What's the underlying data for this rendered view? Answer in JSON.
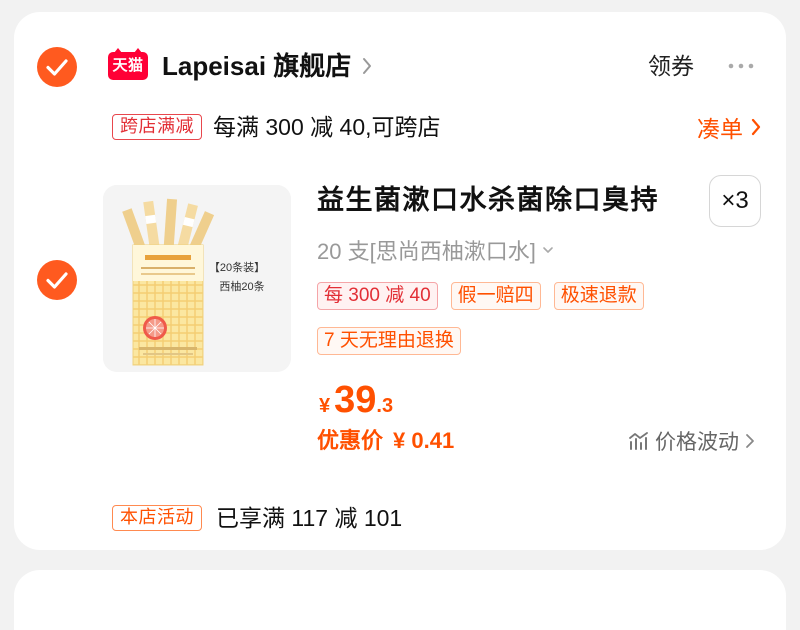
{
  "shop": {
    "selected": true,
    "platform_logo_text": "天猫",
    "name": "Lapeisai 旗舰店",
    "coupon_label": "领券"
  },
  "cross_store_promo": {
    "badge": "跨店满减",
    "text": "每满 300 减 40,可跨店",
    "action_label": "凑单"
  },
  "item": {
    "selected": true,
    "image": {
      "label_line1": "【20条装】",
      "label_line2": "西柚20条"
    },
    "title": "益生菌漱口水杀菌除口臭持",
    "quantity": "×3",
    "sku": "20 支[思尚西柚漱口水]",
    "tags": [
      "每 300 减 40",
      "假一赔四",
      "极速退款",
      "7 天无理由退换"
    ],
    "price": {
      "currency": "¥",
      "integer": "39",
      "decimal": ".3"
    },
    "discount_label": "优惠价",
    "discount_value": "¥ 0.41",
    "price_trend_label": "价格波动"
  },
  "store_activity": {
    "badge": "本店活动",
    "text": "已享满 117 减 101"
  },
  "colors": {
    "accent": "#ff5000",
    "checkbox": "#ff5a1f",
    "promo_red": "#e22f36",
    "tmall_red": "#ff0036",
    "muted_text": "#999999",
    "page_background": "#f2f2f2",
    "card_background": "#ffffff"
  },
  "icons": {
    "shop_check": "checkmark-circle-icon",
    "item_check": "checkmark-circle-icon",
    "shop_link": "chevron-right-icon",
    "more": "more-dots-icon",
    "collect": "chevron-right-icon",
    "sku_expand": "chevron-down-icon",
    "price_trend": "price-trend-icon",
    "price_trend_link": "chevron-right-icon"
  }
}
